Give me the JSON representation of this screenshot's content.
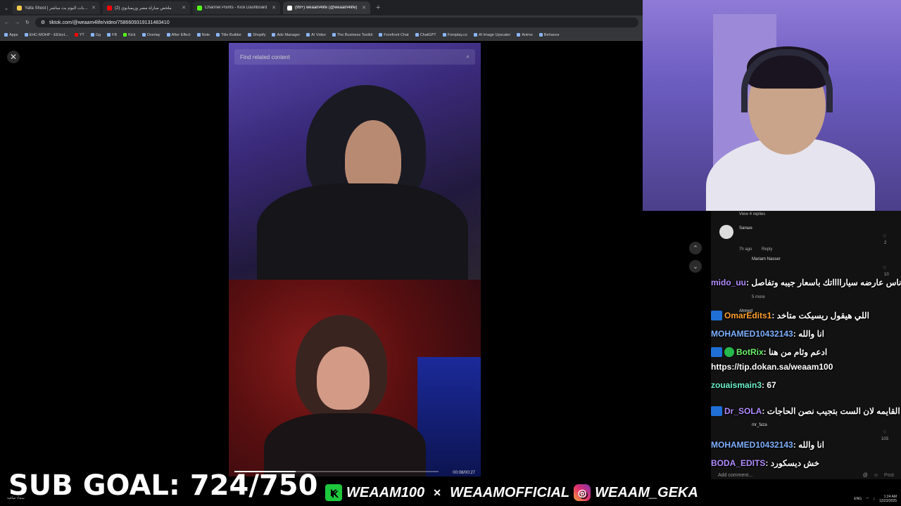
{
  "browser": {
    "tabs": [
      {
        "label": "Yalla Shoot | مشاهدة مباريات اليوم بث مباشر",
        "color": "#f2c94c",
        "active": false
      },
      {
        "label": "(2) ملخص مباراة مصر وزيمبابوي",
        "color": "#ff0000",
        "active": false
      },
      {
        "label": "Channel Points - Kick Dashboard",
        "color": "#53fc18",
        "active": false
      },
      {
        "label": "(99+) weaam4life (@weaam4life)",
        "color": "#ffffff",
        "active": true
      }
    ],
    "url": "tiktok.com/@weaam4life/video/7586609319131483410",
    "bookmarks": [
      "Apps",
      "EHC-MOHP - EElect...",
      "YT",
      "Gg",
      "FB",
      "Kick",
      "Overlay",
      "After Effect",
      "Note",
      "Title Builder",
      "Shopify",
      "Ads Manager",
      "AI Video",
      "The Business Toolkit",
      "Forefront Chat",
      "ChatGPT",
      "Foreplay.co",
      "AI Image Upscaler",
      "Anime",
      "Behance"
    ]
  },
  "tiktok": {
    "search_placeholder": "Find related content",
    "video_time": "00:08/00:27",
    "progress": 0.3,
    "view_replies": "View 4 replies",
    "comment_users": [
      "Sanше",
      "Mariam Nasser",
      "Ahmed",
      "mr_faza"
    ],
    "time_ago": "7h ago",
    "reply_label": "Reply",
    "more_label": "5 more",
    "like_counts": [
      "2",
      "10",
      "103"
    ],
    "add_comment": "Add comment...",
    "post_label": "Post"
  },
  "chat": [
    {
      "user": "mido_uu",
      "msg": "يلا نرن علي ناس عارضه سيارااااتك باسعار جيبه وتفاصل",
      "color": "purple",
      "badge": ""
    },
    {
      "user": "OmarEdits1",
      "msg": "اللي هيقول ريسيكت متاخد",
      "color": "purple",
      "badge": "mod"
    },
    {
      "user": "MOHAMED10432143",
      "msg": "انا والله",
      "color": "blue",
      "badge": ""
    },
    {
      "user": "BotRix",
      "msg": "ادعم وئام من هنا",
      "color": "green",
      "badge": "bot"
    },
    {
      "user": "",
      "msg": "https://tip.dokan.sa/weaam100",
      "color": "",
      "badge": ""
    },
    {
      "user": "zouaismain3",
      "msg": "67",
      "color": "purple",
      "badge": ""
    },
    {
      "user": "Dr_SOLA",
      "msg": "انا مع القايمه لان الست بتجيب نصن الحاجات",
      "color": "purple",
      "badge": "mod"
    },
    {
      "user": "MOHAMED10432143",
      "msg": "انا والله",
      "color": "blue",
      "badge": ""
    },
    {
      "user": "BODA_EDITS",
      "msg": "خش ديسكورد",
      "color": "purple",
      "badge": ""
    }
  ],
  "overlay": {
    "sub_goal": "SUB GOAL: 724/750",
    "kick": "WEAAM100",
    "x": "WEAAMOFFICIAL",
    "instagram": "WEAAM_GEKA"
  },
  "system": {
    "lang": "ENG",
    "time": "1:24 AM",
    "date": "12/23/2025",
    "weather": "سماء صافية"
  }
}
